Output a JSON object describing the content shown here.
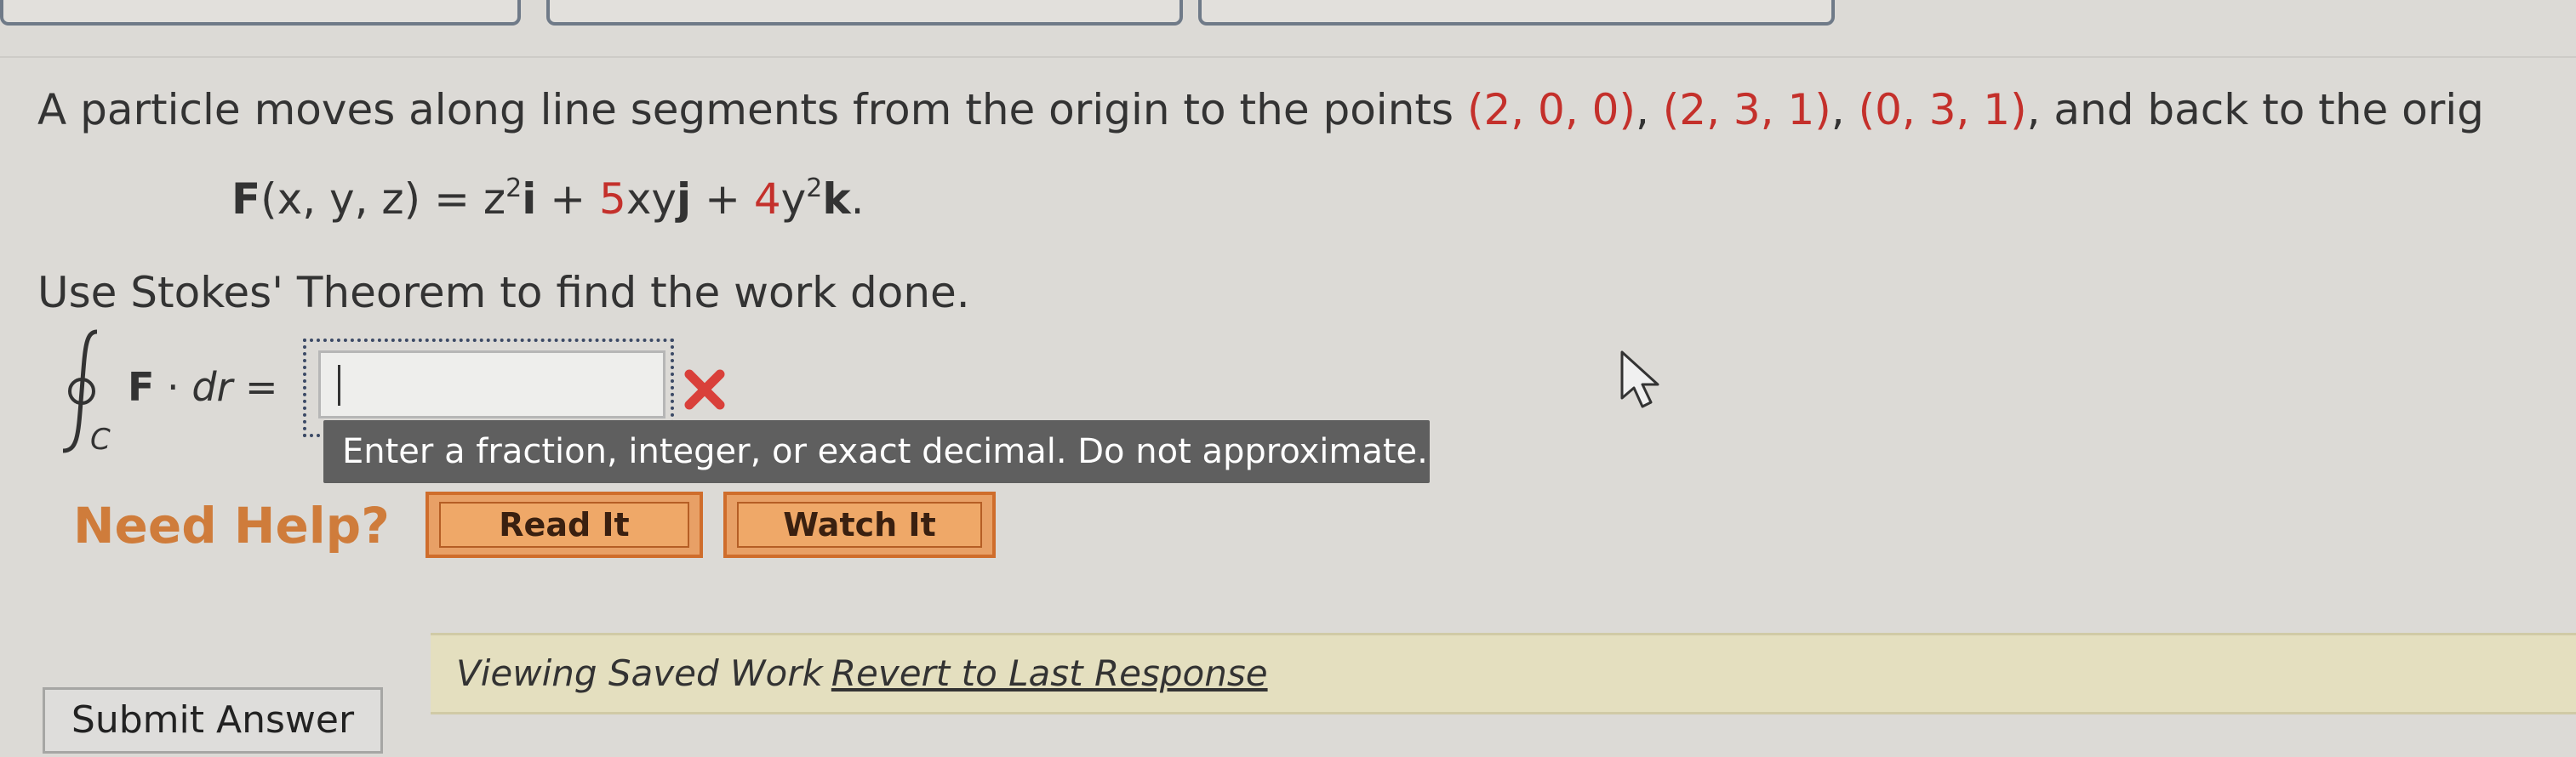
{
  "question": {
    "intro": "A particle moves along line segments from the origin to the points ",
    "point1": "(2, 0, 0)",
    "point2": "(2, 3, 1)",
    "point3": "(0, 3, 1)",
    "sep": ", ",
    "sep_and": ", and back to the orig",
    "highlight_color": "#c4302b"
  },
  "equation": {
    "lhs": "F",
    "args": "(x, y, z) = z",
    "exp1": "2",
    "i": "i",
    "plus1": " + ",
    "coef2": "5",
    "term2": "xy",
    "j": "j",
    "plus2": " + ",
    "coef3": "4",
    "term3": "y",
    "exp3": "2",
    "k": "k",
    "end": "."
  },
  "instruction": "Use Stokes' Theorem to find the work done.",
  "integral": {
    "symbol": "∮",
    "subscript": "C",
    "bold_f": "F",
    "dot": " · ",
    "dr": "dr",
    "equals": " ="
  },
  "answer": {
    "value": "",
    "status": "incorrect-x-icon",
    "hint": "Enter a fraction, integer, or exact decimal. Do not approximate."
  },
  "help": {
    "label": "Need Help?",
    "read_label": "Read It",
    "watch_label": "Watch It"
  },
  "saved": {
    "label": "Viewing Saved Work",
    "link": "Revert to Last Response"
  },
  "submit_label": "Submit Answer"
}
